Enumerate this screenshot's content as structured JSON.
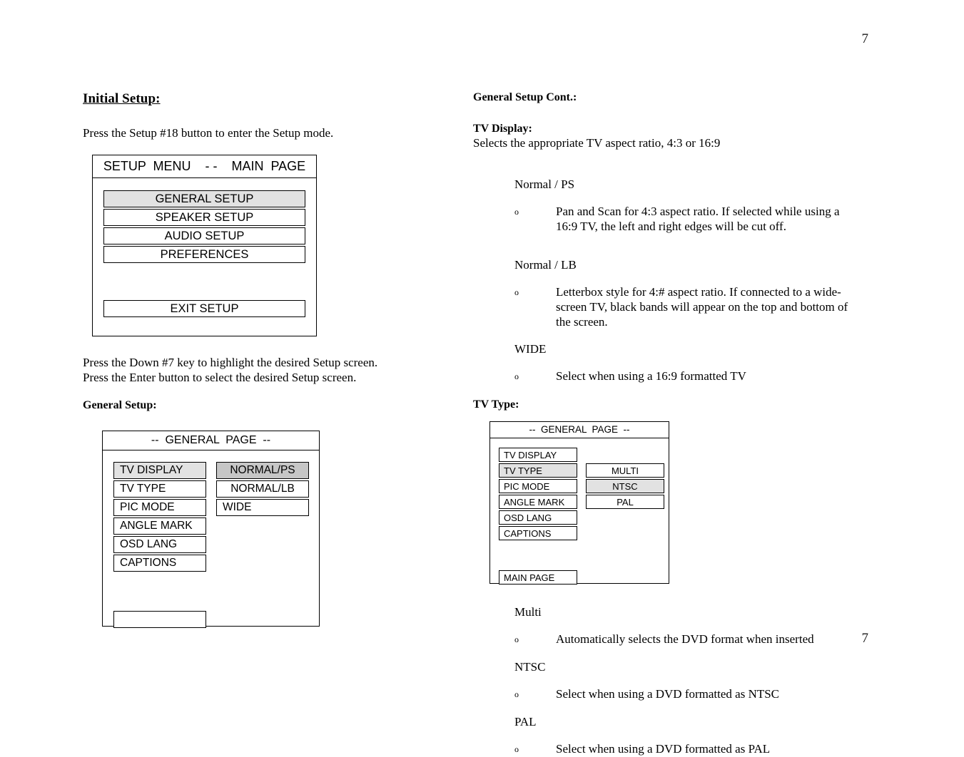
{
  "page": {
    "number_top": "7",
    "number_bottom": "7"
  },
  "left_column": {
    "title": "Initial Setup:",
    "intro": "Press the Setup #18 button to enter the Setup mode.",
    "setup_menu": {
      "title": "SETUP  MENU    - -    MAIN  PAGE",
      "items": [
        {
          "label": "GENERAL SETUP",
          "highlight": "light"
        },
        {
          "label": "SPEAKER SETUP",
          "highlight": "none"
        },
        {
          "label": "AUDIO SETUP",
          "highlight": "none"
        },
        {
          "label": "PREFERENCES",
          "highlight": "none"
        }
      ],
      "exit_label": "EXIT SETUP"
    },
    "instructions": [
      "Press the Down #7 key to highlight the desired Setup screen.",
      "Press the Enter button to select the desired Setup screen."
    ],
    "general_setup_heading": "General Setup:",
    "general_page": {
      "title": "--  GENERAL  PAGE  --",
      "labels": [
        {
          "label": "TV DISPLAY",
          "highlight": "light"
        },
        {
          "label": "TV TYPE",
          "highlight": "none"
        },
        {
          "label": "PIC MODE",
          "highlight": "none"
        },
        {
          "label": "ANGLE MARK",
          "highlight": "none"
        },
        {
          "label": "OSD LANG",
          "highlight": "none"
        },
        {
          "label": "CAPTIONS",
          "highlight": "none"
        }
      ],
      "values": [
        {
          "label": "NORMAL/PS",
          "highlight": "dark",
          "align": "center"
        },
        {
          "label": "NORMAL/LB",
          "highlight": "none",
          "align": "center"
        },
        {
          "label": "WIDE",
          "highlight": "none",
          "align": "left"
        }
      ],
      "bottom_button": ""
    }
  },
  "right_column": {
    "cont_heading": "General Setup Cont.:",
    "tv_display_heading": "TV Display:",
    "tv_display_desc": "Selects the appropriate TV aspect ratio, 4:3 or 16:9",
    "tv_display_options": [
      {
        "term": "Normal / PS",
        "bullet": "o",
        "text": "Pan and Scan for 4:3 aspect ratio.  If selected while using a 16:9 TV, the left and right edges will be cut off."
      },
      {
        "term": "Normal / LB",
        "bullet": "o",
        "text": "Letterbox style for 4:# aspect ratio.  If connected to a wide-screen TV,  black bands will appear on the top and bottom of the screen."
      },
      {
        "term": "WIDE",
        "bullet": "o",
        "text": "Select when using a 16:9 formatted TV"
      }
    ],
    "tv_type_heading": "TV Type:",
    "tv_type_page": {
      "title": "--  GENERAL  PAGE  --",
      "labels": [
        {
          "label": "TV DISPLAY",
          "highlight": "none"
        },
        {
          "label": "TV TYPE",
          "highlight": "light"
        },
        {
          "label": "PIC MODE",
          "highlight": "none"
        },
        {
          "label": "ANGLE MARK",
          "highlight": "none"
        },
        {
          "label": "OSD LANG",
          "highlight": "none"
        },
        {
          "label": "CAPTIONS",
          "highlight": "none"
        }
      ],
      "values": [
        {
          "label": "MULTI",
          "highlight": "none"
        },
        {
          "label": "NTSC",
          "highlight": "light"
        },
        {
          "label": "PAL",
          "highlight": "none"
        }
      ],
      "bottom_button": "MAIN PAGE"
    },
    "tv_type_options": [
      {
        "term": "Multi",
        "bullet": "o",
        "text": "Automatically selects the DVD format when inserted"
      },
      {
        "term": "NTSC",
        "bullet": "o",
        "text": "Select when using a DVD formatted as NTSC"
      },
      {
        "term": "PAL",
        "bullet": "o",
        "text": "Select when using a DVD formatted as PAL"
      }
    ]
  }
}
